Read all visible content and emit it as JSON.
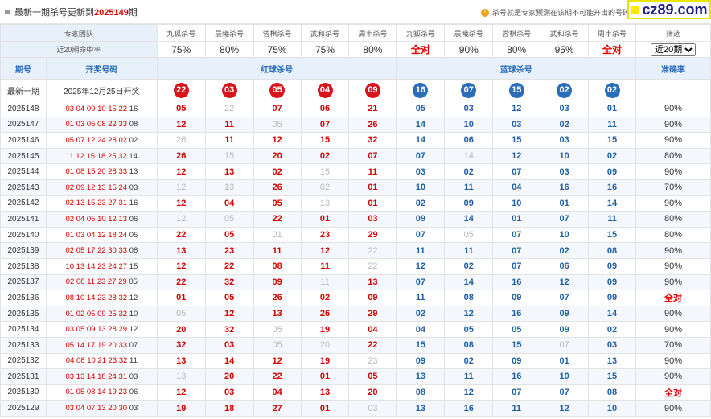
{
  "header": {
    "title_prefix": "最新一期杀号更新到",
    "title_period": "2025149",
    "title_suffix": "期",
    "notice": "杀号就是专家预测在该期不可能开出的号码"
  },
  "watermark": "cz89.com",
  "experts": {
    "label": "专家团队",
    "names": [
      "九狐杀号",
      "晨曦杀号",
      "蓉棋杀号",
      "武和杀号",
      "周丰杀号",
      "九狐杀号",
      "晨曦杀号",
      "蓉棋杀号",
      "武和杀号",
      "周丰杀号"
    ],
    "filter_label": "筛选"
  },
  "hit_rate": {
    "label": "近20期命中率",
    "values": [
      "75%",
      "80%",
      "75%",
      "75%",
      "80%",
      "全对",
      "90%",
      "80%",
      "95%",
      "全对"
    ],
    "select_value": "近20期",
    "select_options": [
      "近20期"
    ]
  },
  "columns": {
    "period": "期号",
    "draw": "开奖号码",
    "red_kill": "红球杀号",
    "blue_kill": "蓝球杀号",
    "accuracy": "准确率"
  },
  "latest": {
    "label": "最新一期",
    "draw_date": "2025年12月25日开奖",
    "red": [
      "22",
      "03",
      "05",
      "04",
      "09"
    ],
    "blue": [
      "16",
      "07",
      "15",
      "02",
      "02"
    ]
  },
  "rows": [
    {
      "period": "2025148",
      "red_draw": "03 04 09 10 15 22",
      "blue_draw": "16",
      "red": [
        [
          "05",
          1
        ],
        [
          "22",
          0
        ],
        [
          "07",
          1
        ],
        [
          "06",
          1
        ],
        [
          "21",
          1
        ]
      ],
      "blue": [
        [
          "05",
          1
        ],
        [
          "03",
          1
        ],
        [
          "12",
          1
        ],
        [
          "03",
          1
        ],
        [
          "01",
          1
        ]
      ],
      "acc": "90%"
    },
    {
      "period": "2025147",
      "red_draw": "01 03 05 08 22 33",
      "blue_draw": "08",
      "red": [
        [
          "12",
          1
        ],
        [
          "11",
          1
        ],
        [
          "05",
          0
        ],
        [
          "07",
          1
        ],
        [
          "26",
          1
        ]
      ],
      "blue": [
        [
          "14",
          1
        ],
        [
          "10",
          1
        ],
        [
          "03",
          1
        ],
        [
          "02",
          1
        ],
        [
          "11",
          1
        ]
      ],
      "acc": "90%"
    },
    {
      "period": "2025146",
      "red_draw": "05 07 12 24 28 02",
      "blue_draw": "02",
      "red": [
        [
          "26",
          0
        ],
        [
          "11",
          1
        ],
        [
          "12",
          1
        ],
        [
          "15",
          1
        ],
        [
          "32",
          1
        ]
      ],
      "blue": [
        [
          "14",
          1
        ],
        [
          "06",
          1
        ],
        [
          "15",
          1
        ],
        [
          "03",
          1
        ],
        [
          "15",
          1
        ]
      ],
      "acc": "90%"
    },
    {
      "period": "2025145",
      "red_draw": "11 12 15 18 25 32",
      "blue_draw": "14",
      "red": [
        [
          "26",
          1
        ],
        [
          "15",
          0
        ],
        [
          "20",
          1
        ],
        [
          "02",
          1
        ],
        [
          "07",
          1
        ]
      ],
      "blue": [
        [
          "07",
          1
        ],
        [
          "14",
          0
        ],
        [
          "12",
          1
        ],
        [
          "10",
          1
        ],
        [
          "02",
          1
        ]
      ],
      "acc": "80%"
    },
    {
      "period": "2025144",
      "red_draw": "01 08 15 20 28 33",
      "blue_draw": "13",
      "red": [
        [
          "12",
          1
        ],
        [
          "13",
          1
        ],
        [
          "02",
          1
        ],
        [
          "15",
          0
        ],
        [
          "11",
          1
        ]
      ],
      "blue": [
        [
          "03",
          1
        ],
        [
          "02",
          1
        ],
        [
          "07",
          1
        ],
        [
          "03",
          1
        ],
        [
          "09",
          1
        ]
      ],
      "acc": "90%"
    },
    {
      "period": "2025143",
      "red_draw": "02 09 12 13 15 24",
      "blue_draw": "03",
      "red": [
        [
          "12",
          0
        ],
        [
          "13",
          0
        ],
        [
          "26",
          1
        ],
        [
          "02",
          0
        ],
        [
          "01",
          1
        ]
      ],
      "blue": [
        [
          "10",
          1
        ],
        [
          "11",
          1
        ],
        [
          "04",
          1
        ],
        [
          "16",
          1
        ],
        [
          "16",
          1
        ]
      ],
      "acc": "70%"
    },
    {
      "period": "2025142",
      "red_draw": "02 13 15 23 27 31",
      "blue_draw": "16",
      "red": [
        [
          "12",
          1
        ],
        [
          "04",
          1
        ],
        [
          "05",
          1
        ],
        [
          "13",
          0
        ],
        [
          "01",
          1
        ]
      ],
      "blue": [
        [
          "02",
          1
        ],
        [
          "09",
          1
        ],
        [
          "10",
          1
        ],
        [
          "01",
          1
        ],
        [
          "14",
          1
        ]
      ],
      "acc": "90%"
    },
    {
      "period": "2025141",
      "red_draw": "02 04 05 10 12 13",
      "blue_draw": "06",
      "red": [
        [
          "12",
          0
        ],
        [
          "05",
          0
        ],
        [
          "22",
          1
        ],
        [
          "01",
          1
        ],
        [
          "03",
          1
        ]
      ],
      "blue": [
        [
          "09",
          1
        ],
        [
          "14",
          1
        ],
        [
          "01",
          1
        ],
        [
          "07",
          1
        ],
        [
          "11",
          1
        ]
      ],
      "acc": "80%"
    },
    {
      "period": "2025140",
      "red_draw": "01 03 04 12 18 24",
      "blue_draw": "05",
      "red": [
        [
          "22",
          1
        ],
        [
          "05",
          1
        ],
        [
          "01",
          0
        ],
        [
          "23",
          1
        ],
        [
          "29",
          1
        ]
      ],
      "blue": [
        [
          "07",
          1
        ],
        [
          "05",
          0
        ],
        [
          "07",
          1
        ],
        [
          "10",
          1
        ],
        [
          "15",
          1
        ]
      ],
      "acc": "80%"
    },
    {
      "period": "2025139",
      "red_draw": "02 05 17 22 30 33",
      "blue_draw": "08",
      "red": [
        [
          "13",
          1
        ],
        [
          "23",
          1
        ],
        [
          "11",
          1
        ],
        [
          "12",
          1
        ],
        [
          "22",
          0
        ]
      ],
      "blue": [
        [
          "11",
          1
        ],
        [
          "11",
          1
        ],
        [
          "07",
          1
        ],
        [
          "02",
          1
        ],
        [
          "08",
          1
        ]
      ],
      "acc": "90%"
    },
    {
      "period": "2025138",
      "red_draw": "10 13 14 23 24 27",
      "blue_draw": "15",
      "red": [
        [
          "12",
          1
        ],
        [
          "22",
          1
        ],
        [
          "08",
          1
        ],
        [
          "11",
          1
        ],
        [
          "22",
          0
        ]
      ],
      "blue": [
        [
          "12",
          1
        ],
        [
          "02",
          1
        ],
        [
          "07",
          1
        ],
        [
          "06",
          1
        ],
        [
          "09",
          1
        ]
      ],
      "acc": "90%"
    },
    {
      "period": "2025137",
      "red_draw": "02 08 11 23 27 29",
      "blue_draw": "05",
      "red": [
        [
          "22",
          1
        ],
        [
          "32",
          1
        ],
        [
          "09",
          1
        ],
        [
          "11",
          0
        ],
        [
          "13",
          1
        ]
      ],
      "blue": [
        [
          "07",
          1
        ],
        [
          "14",
          1
        ],
        [
          "16",
          1
        ],
        [
          "12",
          1
        ],
        [
          "09",
          1
        ]
      ],
      "acc": "90%"
    },
    {
      "period": "2025136",
      "red_draw": "08 10 14 23 28 32",
      "blue_draw": "12",
      "red": [
        [
          "01",
          1
        ],
        [
          "05",
          1
        ],
        [
          "26",
          1
        ],
        [
          "02",
          1
        ],
        [
          "09",
          1
        ]
      ],
      "blue": [
        [
          "11",
          1
        ],
        [
          "08",
          1
        ],
        [
          "09",
          1
        ],
        [
          "07",
          1
        ],
        [
          "09",
          1
        ]
      ],
      "acc": "全对"
    },
    {
      "period": "2025135",
      "red_draw": "01 02 05 09 25 32",
      "blue_draw": "10",
      "red": [
        [
          "05",
          0
        ],
        [
          "12",
          1
        ],
        [
          "13",
          1
        ],
        [
          "26",
          1
        ],
        [
          "29",
          1
        ]
      ],
      "blue": [
        [
          "02",
          1
        ],
        [
          "12",
          1
        ],
        [
          "16",
          1
        ],
        [
          "09",
          1
        ],
        [
          "14",
          1
        ]
      ],
      "acc": "90%"
    },
    {
      "period": "2025134",
      "red_draw": "03 05 09 13 28 29",
      "blue_draw": "12",
      "red": [
        [
          "20",
          1
        ],
        [
          "32",
          1
        ],
        [
          "05",
          0
        ],
        [
          "19",
          1
        ],
        [
          "04",
          1
        ]
      ],
      "blue": [
        [
          "04",
          1
        ],
        [
          "05",
          1
        ],
        [
          "05",
          1
        ],
        [
          "09",
          1
        ],
        [
          "02",
          1
        ]
      ],
      "acc": "90%"
    },
    {
      "period": "2025133",
      "red_draw": "05 14 17 19 20 33",
      "blue_draw": "07",
      "red": [
        [
          "32",
          1
        ],
        [
          "03",
          1
        ],
        [
          "05",
          0
        ],
        [
          "20",
          0
        ],
        [
          "22",
          1
        ]
      ],
      "blue": [
        [
          "15",
          1
        ],
        [
          "08",
          1
        ],
        [
          "15",
          1
        ],
        [
          "07",
          0
        ],
        [
          "03",
          1
        ]
      ],
      "acc": "70%"
    },
    {
      "period": "2025132",
      "red_draw": "04 08 10 21 23 32",
      "blue_draw": "11",
      "red": [
        [
          "13",
          1
        ],
        [
          "14",
          1
        ],
        [
          "12",
          1
        ],
        [
          "19",
          1
        ],
        [
          "23",
          0
        ]
      ],
      "blue": [
        [
          "09",
          1
        ],
        [
          "02",
          1
        ],
        [
          "09",
          1
        ],
        [
          "01",
          1
        ],
        [
          "13",
          1
        ]
      ],
      "acc": "90%"
    },
    {
      "period": "2025131",
      "red_draw": "03 13 14 18 24 31",
      "blue_draw": "03",
      "red": [
        [
          "13",
          0
        ],
        [
          "20",
          1
        ],
        [
          "22",
          1
        ],
        [
          "01",
          1
        ],
        [
          "05",
          1
        ]
      ],
      "blue": [
        [
          "13",
          1
        ],
        [
          "11",
          1
        ],
        [
          "16",
          1
        ],
        [
          "10",
          1
        ],
        [
          "15",
          1
        ]
      ],
      "acc": "90%"
    },
    {
      "period": "2025130",
      "red_draw": "01 05 08 14 19 23",
      "blue_draw": "06",
      "red": [
        [
          "12",
          1
        ],
        [
          "03",
          1
        ],
        [
          "04",
          1
        ],
        [
          "13",
          1
        ],
        [
          "20",
          1
        ]
      ],
      "blue": [
        [
          "08",
          1
        ],
        [
          "12",
          1
        ],
        [
          "07",
          1
        ],
        [
          "07",
          1
        ],
        [
          "08",
          1
        ]
      ],
      "acc": "全对"
    },
    {
      "period": "2025129",
      "red_draw": "03 04 07 13 20 30",
      "blue_draw": "03",
      "red": [
        [
          "19",
          1
        ],
        [
          "18",
          1
        ],
        [
          "27",
          1
        ],
        [
          "01",
          1
        ],
        [
          "03",
          0
        ]
      ],
      "blue": [
        [
          "13",
          1
        ],
        [
          "16",
          1
        ],
        [
          "11",
          1
        ],
        [
          "12",
          1
        ],
        [
          "10",
          1
        ]
      ],
      "acc": "90%"
    }
  ]
}
